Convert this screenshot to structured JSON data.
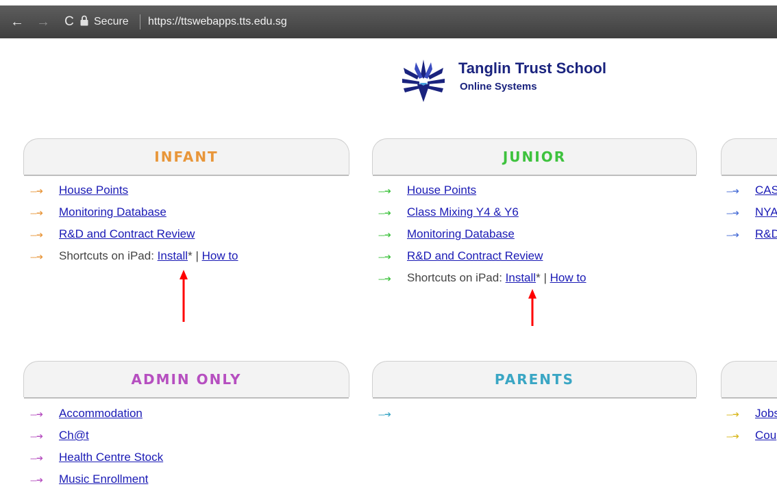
{
  "browser": {
    "secure_label": "Secure",
    "url": "https://ttswebapps.tts.edu.sg",
    "back_icon": "←",
    "forward_icon": "→",
    "reload_icon": "C"
  },
  "header": {
    "school_name": "Tanglin Trust School",
    "subtitle": "Online Systems"
  },
  "sections": {
    "infant": {
      "title": "INFANT",
      "color": "#e8963a",
      "items": [
        "House Points",
        "Monitoring Database",
        "R&D and Contract Review"
      ],
      "shortcut_label": "Shortcuts on iPad:",
      "install_label": "Install",
      "install_suffix": "*",
      "sep": "|",
      "howto_label": "How to"
    },
    "junior": {
      "title": "JUNIOR",
      "color": "#3ec23e",
      "items": [
        "House Points",
        "Class Mixing Y4 & Y6",
        "Monitoring Database",
        "R&D and Contract Review"
      ],
      "shortcut_label": "Shortcuts on iPad:",
      "install_label": "Install",
      "install_suffix": "*",
      "sep": "|",
      "howto_label": "How to"
    },
    "senior_partial": {
      "color": "#4a6fd6",
      "items": [
        "CAS",
        "NYA",
        "R&D"
      ]
    },
    "admin": {
      "title": "ADMIN ONLY",
      "color": "#b64fc0",
      "items": [
        "Accommodation",
        "Ch@t",
        "Health Centre Stock",
        "Music Enrollment"
      ]
    },
    "parents": {
      "title": "PARENTS",
      "color": "#3aa6c4",
      "items": []
    },
    "other_partial": {
      "color": "#d9b820",
      "items": [
        "Jobs",
        "Cou"
      ]
    }
  },
  "arrow_glyph": "---➔",
  "annotation_color": "#ff0000"
}
